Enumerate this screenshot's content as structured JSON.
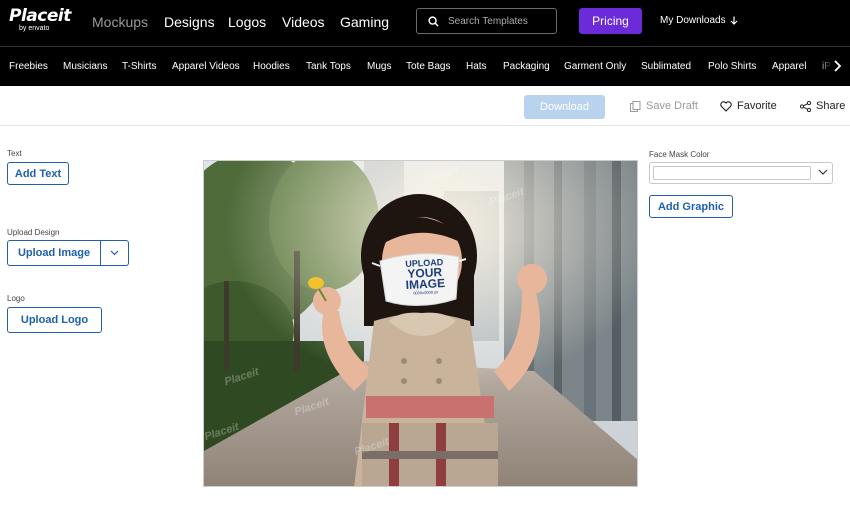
{
  "logo": {
    "name": "Placeit",
    "sub": "by envato"
  },
  "nav": {
    "links": [
      "Mockups",
      "Designs",
      "Logos",
      "Videos",
      "Gaming"
    ],
    "search_placeholder": "Search Templates",
    "pricing": "Pricing",
    "downloads": "My Downloads"
  },
  "categories": [
    "Freebies",
    "Musicians",
    "T-Shirts",
    "Apparel Videos",
    "Hoodies",
    "Tank Tops",
    "Mugs",
    "Tote Bags",
    "Hats",
    "Packaging",
    "Garment Only",
    "Sublimated",
    "Polo Shirts",
    "Apparel",
    "iP"
  ],
  "actions": {
    "download": "Download",
    "save_draft": "Save Draft",
    "favorite": "Favorite",
    "share": "Share"
  },
  "left_panel": {
    "text_label": "Text",
    "add_text": "Add Text",
    "upload_label": "Upload Design",
    "upload_image": "Upload Image",
    "logo_label": "Logo",
    "upload_logo": "Upload Logo"
  },
  "right_panel": {
    "mask_color_label": "Face Mask Color",
    "add_graphic": "Add Graphic"
  },
  "mockup": {
    "mask_line1": "UPLOAD",
    "mask_line2": "YOUR",
    "mask_line3": "IMAGE",
    "mask_line4": "0000x0000 px",
    "watermark": "Placeit"
  },
  "colors": {
    "accent": "#6c2bd9",
    "primary": "#1f5fae",
    "download_disabled": "#b9d3ef"
  }
}
